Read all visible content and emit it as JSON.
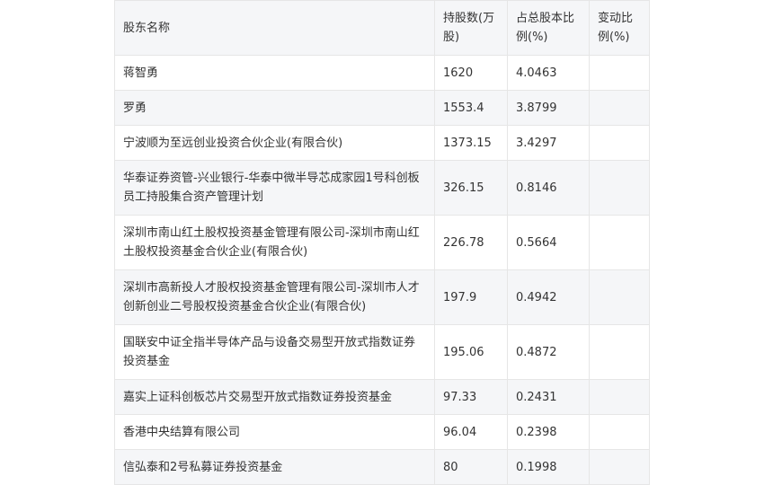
{
  "table": {
    "headers": {
      "name": "股东名称",
      "shares": "持股数(万股)",
      "pct": "占总股本比例(%)",
      "change": "变动比例(%)"
    },
    "rows": [
      {
        "name": "蒋智勇",
        "shares": "1620",
        "pct": "4.0463",
        "change": ""
      },
      {
        "name": "罗勇",
        "shares": "1553.4",
        "pct": "3.8799",
        "change": ""
      },
      {
        "name": "宁波顺为至远创业投资合伙企业(有限合伙)",
        "shares": "1373.15",
        "pct": "3.4297",
        "change": ""
      },
      {
        "name": "华泰证券资管-兴业银行-华泰中微半导芯成家园1号科创板员工持股集合资产管理计划",
        "shares": "326.15",
        "pct": "0.8146",
        "change": ""
      },
      {
        "name": "深圳市南山红土股权投资基金管理有限公司-深圳市南山红土股权投资基金合伙企业(有限合伙)",
        "shares": "226.78",
        "pct": "0.5664",
        "change": ""
      },
      {
        "name": "深圳市高新投人才股权投资基金管理有限公司-深圳市人才创新创业二号股权投资基金合伙企业(有限合伙)",
        "shares": "197.9",
        "pct": "0.4942",
        "change": ""
      },
      {
        "name": "国联安中证全指半导体产品与设备交易型开放式指数证券投资基金",
        "shares": "195.06",
        "pct": "0.4872",
        "change": ""
      },
      {
        "name": "嘉实上证科创板芯片交易型开放式指数证券投资基金",
        "shares": "97.33",
        "pct": "0.2431",
        "change": ""
      },
      {
        "name": "香港中央结算有限公司",
        "shares": "96.04",
        "pct": "0.2398",
        "change": ""
      },
      {
        "name": "信弘泰和2号私募证券投资基金",
        "shares": "80",
        "pct": "0.1998",
        "change": ""
      }
    ]
  }
}
